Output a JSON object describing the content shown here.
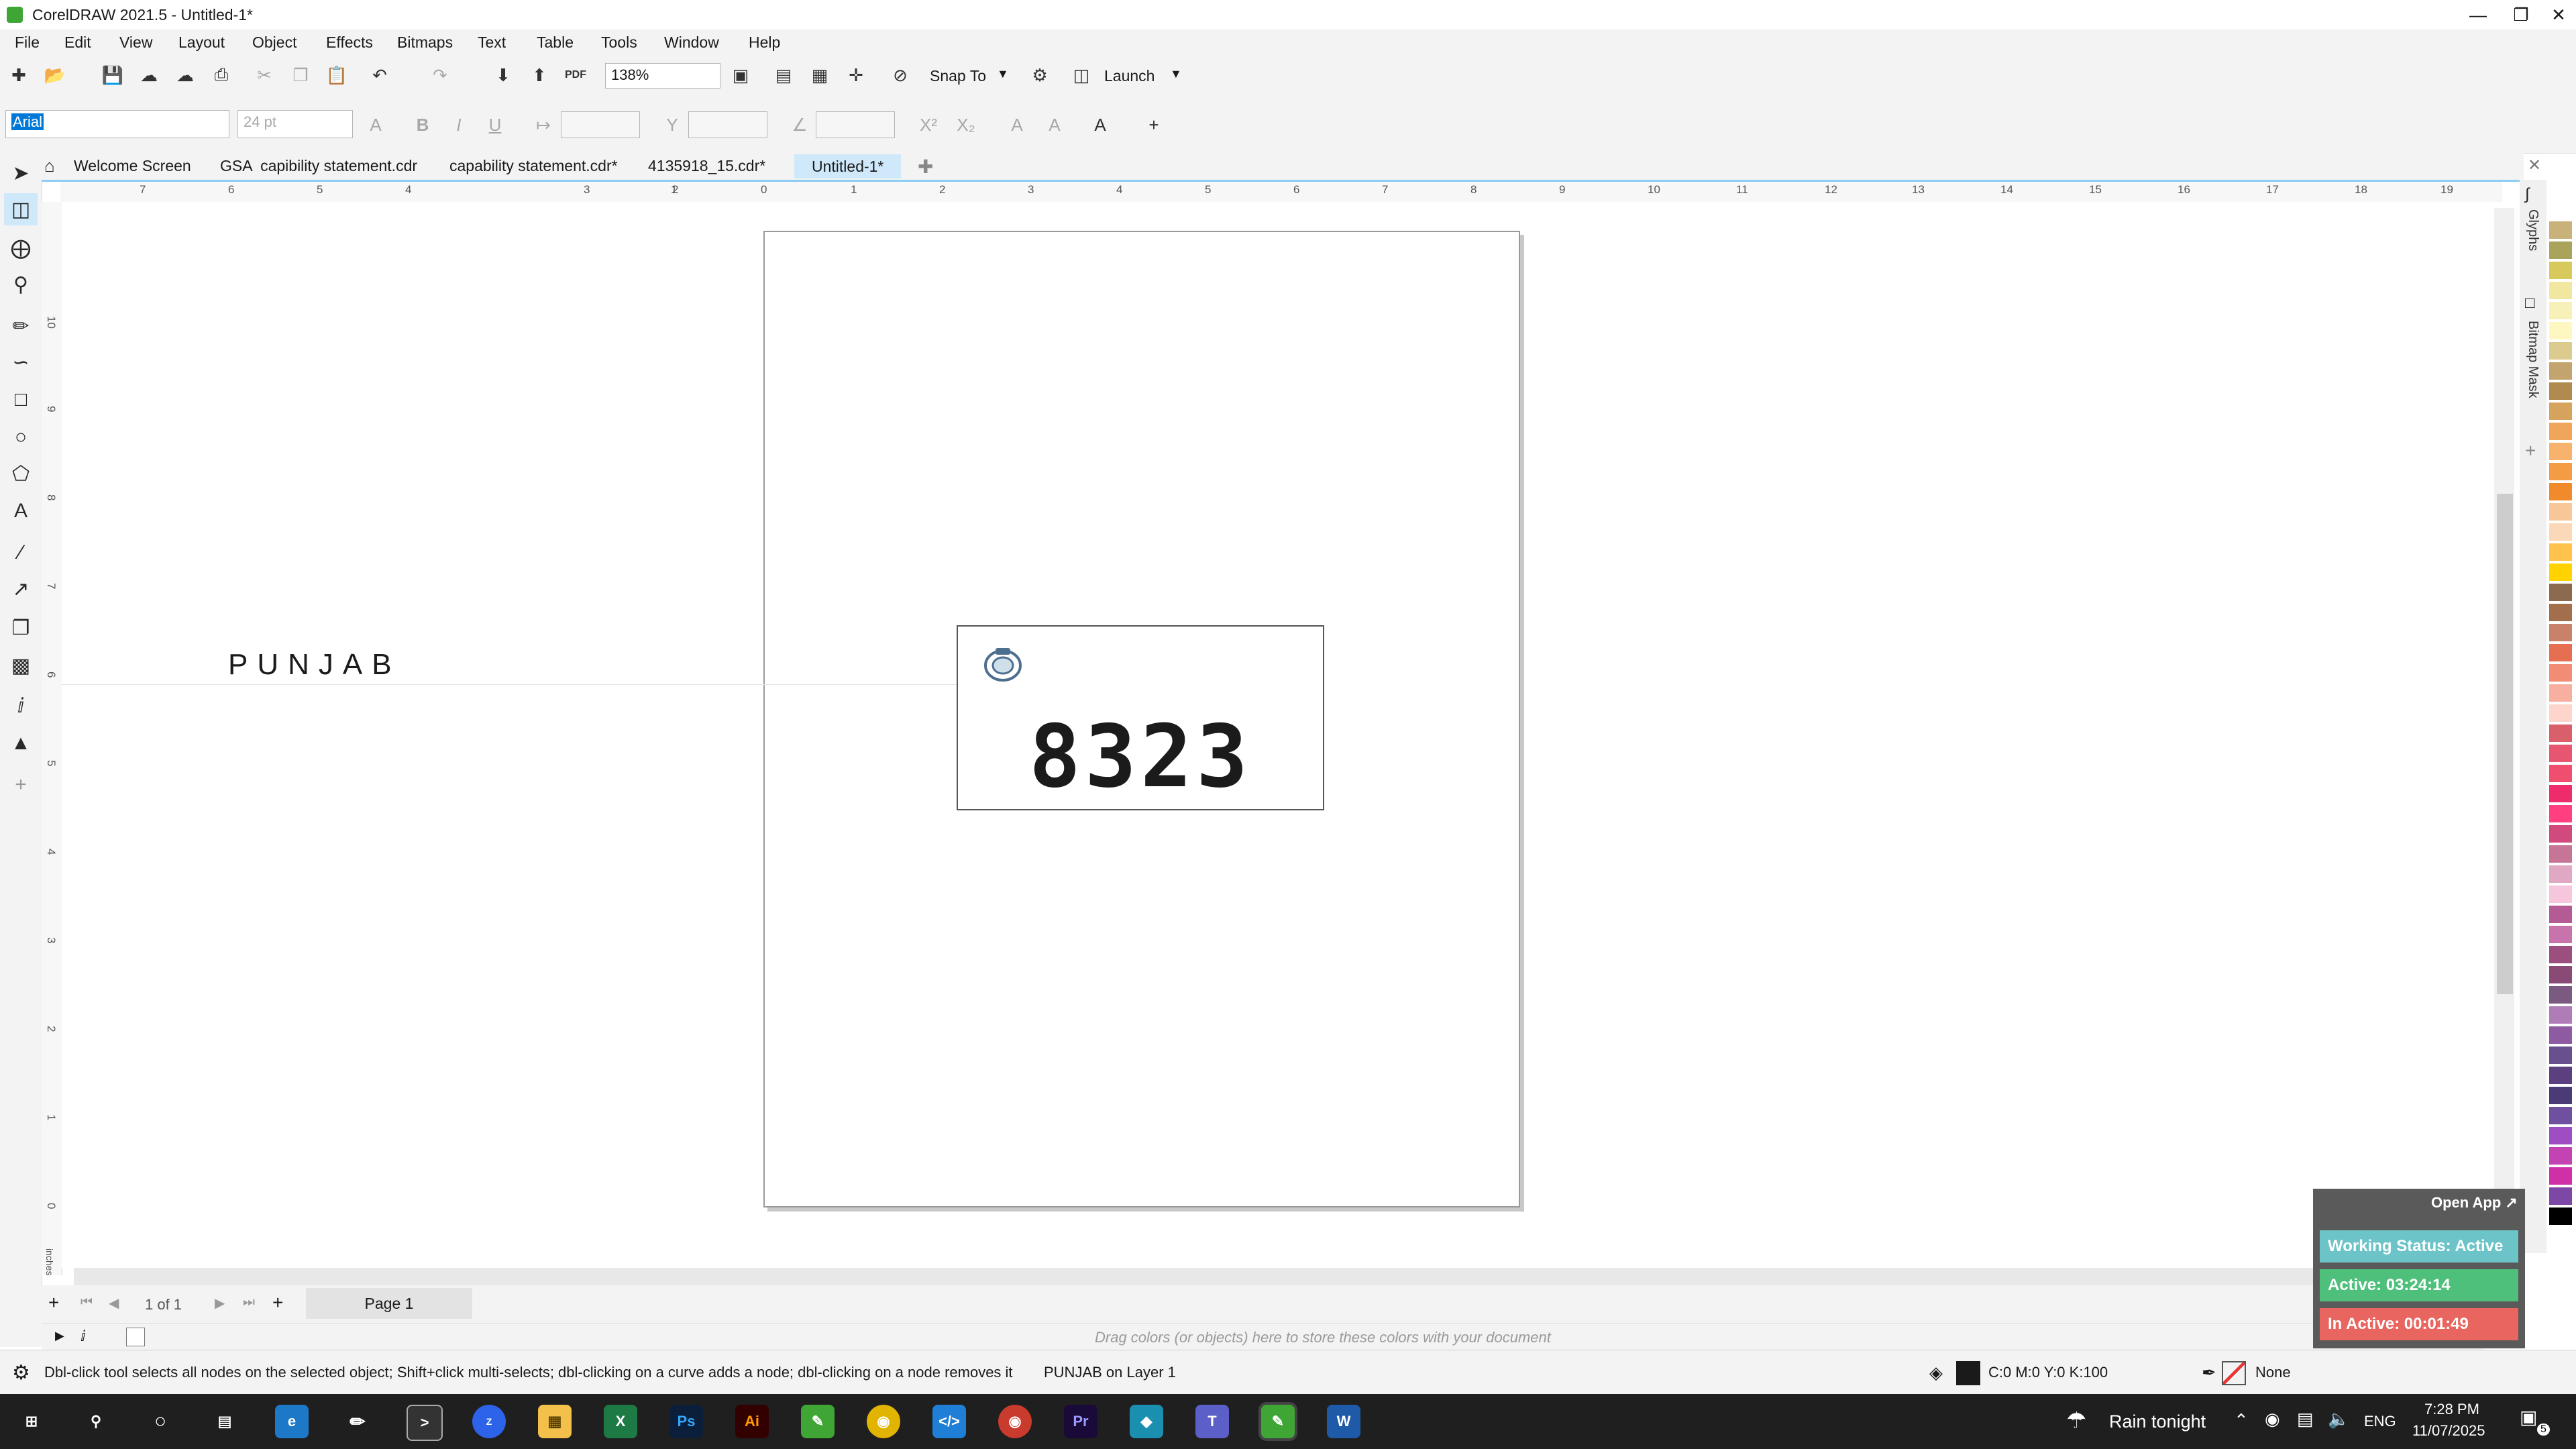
{
  "window": {
    "title": "CorelDRAW 2021.5 - Untitled-1*"
  },
  "menu": [
    "File",
    "Edit",
    "View",
    "Layout",
    "Object",
    "Effects",
    "Bitmaps",
    "Text",
    "Table",
    "Tools",
    "Window",
    "Help"
  ],
  "standard_toolbar": {
    "zoom": "138%",
    "snap_label": "Snap To",
    "launch_label": "Launch",
    "pdf_label": "PDF"
  },
  "property_bar": {
    "font_family": "Arial",
    "font_size": "24 pt"
  },
  "tabs": [
    "Welcome Screen",
    "GSA  capibility statement.cdr",
    "capability statement.cdr*",
    "4135918_15.cdr*",
    "Untitled-1*"
  ],
  "ruler": {
    "h_ticks": [
      "7",
      "6",
      "5",
      "4",
      "3",
      "2",
      "1",
      "0",
      "1",
      "2",
      "3",
      "4",
      "5",
      "6",
      "7",
      "8",
      "9",
      "10",
      "11",
      "12",
      "13",
      "14",
      "15",
      "16",
      "17",
      "18",
      "19"
    ],
    "v_ticks": [
      "10",
      "9",
      "8",
      "7",
      "6",
      "5",
      "4",
      "3",
      "2",
      "1",
      "0"
    ],
    "unit": "inches"
  },
  "canvas": {
    "outside_text": "PUNJAB",
    "plate_number": "8323"
  },
  "dockers": {
    "glyphs": "Glyphs",
    "bitmap_mask": "Bitmap Mask"
  },
  "palette": [
    "#c9b27a",
    "#a9a35c",
    "#d8c95c",
    "#f1e7a0",
    "#f7f0b9",
    "#fff7c2",
    "#dccb8e",
    "#c3a46e",
    "#b08a4e",
    "#d6a35f",
    "#f0a65a",
    "#f7b36e",
    "#f49b45",
    "#f08a2a",
    "#f7c79a",
    "#fbd9b8",
    "#ffc34d",
    "#ffd200",
    "#8b6a4f",
    "#a36e4b",
    "#c9826a",
    "#e66f52",
    "#f28c74",
    "#f7b0a0",
    "#fdd5cb",
    "#d9606a",
    "#e75670",
    "#f04e6e",
    "#ee2c6c",
    "#ff3f80",
    "#d14a7e",
    "#c77597",
    "#e0a8c2",
    "#f5c6dc",
    "#b45a94",
    "#c873ab",
    "#9c4f7e",
    "#8a4a76",
    "#7a5a80",
    "#b07cb8",
    "#8e5aa2",
    "#6a4f8e",
    "#5b3f7f",
    "#4a3a75",
    "#6f4fa0",
    "#9e4ec2",
    "#c443b2",
    "#d02fa8",
    "#7d47a6",
    "#000000"
  ],
  "page_nav": {
    "counter": "1 of 1",
    "page_tab": "Page 1"
  },
  "color_bar": {
    "hint": "Drag colors (or objects) here to store these colors with your document"
  },
  "status": {
    "hint": "Dbl-click tool selects all nodes on the selected object; Shift+click multi-selects; dbl-clicking on a curve adds a node; dbl-clicking on a node removes it",
    "object": "PUNJAB on Layer 1",
    "fill": "C:0 M:0 Y:0 K:100",
    "outline": "None"
  },
  "widget": {
    "open_app": "Open App ↗",
    "working_status": "Working Status: Active",
    "active": "Active: 03:24:14",
    "inactive": "In Active: 00:01:49"
  },
  "taskbar": {
    "weather": "Rain tonight",
    "lang": "ENG",
    "time": "7:28 PM",
    "date": "11/07/2025",
    "notifications": "5"
  },
  "colors": {
    "accent": "#8ccdf5",
    "active_tab": "#cfe9fb",
    "status_green": "#4fc07c",
    "status_teal": "#6cc3c8",
    "status_red": "#e8665f"
  }
}
